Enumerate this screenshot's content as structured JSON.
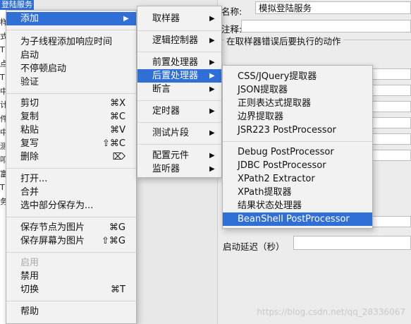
{
  "background": {
    "tree_selected": "登陆服务",
    "tree_chars": [
      "样",
      "式",
      "T",
      "点",
      "T",
      "中",
      "计",
      "件",
      "中",
      "测",
      "叩",
      "富",
      "T",
      "务"
    ],
    "name_label": "名称:",
    "name_value": "模拟登陆服务",
    "comment_label": "注释:",
    "group_title": "在取样器错误后要执行的动作",
    "delay_label": "启动延迟（秒）",
    "watermark": "https://blog.csdn.net/qq_28336067"
  },
  "main_menu": {
    "items": [
      {
        "label": "添加",
        "arrow": "▶",
        "highlight": true
      },
      {
        "label": "为子线程添加响应时间"
      },
      {
        "label": "启动"
      },
      {
        "label": "不停顿启动"
      },
      {
        "label": "验证"
      },
      {
        "label": "剪切",
        "shortcut": "⌘X"
      },
      {
        "label": "复制",
        "shortcut": "⌘C"
      },
      {
        "label": "粘贴",
        "shortcut": "⌘V"
      },
      {
        "label": "复写",
        "shortcut": "⇧⌘C"
      },
      {
        "label": "删除",
        "shortcut": "⌦"
      },
      {
        "label": "打开..."
      },
      {
        "label": "合并"
      },
      {
        "label": "选中部分保存为..."
      },
      {
        "label": "保存节点为图片",
        "shortcut": "⌘G"
      },
      {
        "label": "保存屏幕为图片",
        "shortcut": "⇧⌘G"
      },
      {
        "label": "启用",
        "disabled": true
      },
      {
        "label": "禁用"
      },
      {
        "label": "切换",
        "shortcut": "⌘T"
      },
      {
        "label": "帮助"
      }
    ]
  },
  "add_menu": {
    "items": [
      {
        "label": "取样器",
        "arrow": "▶"
      },
      {
        "label": "逻辑控制器",
        "arrow": "▶"
      },
      {
        "label": "前置处理器",
        "arrow": "▶"
      },
      {
        "label": "后置处理器",
        "arrow": "▶",
        "highlight": true
      },
      {
        "label": "断言",
        "arrow": "▶"
      },
      {
        "label": "定时器",
        "arrow": "▶"
      },
      {
        "label": "测试片段",
        "arrow": "▶"
      },
      {
        "label": "配置元件",
        "arrow": "▶"
      },
      {
        "label": "监听器",
        "arrow": "▶"
      }
    ]
  },
  "post_menu": {
    "items": [
      {
        "label": "CSS/JQuery提取器"
      },
      {
        "label": "JSON提取器"
      },
      {
        "label": "正则表达式提取器"
      },
      {
        "label": "边界提取器"
      },
      {
        "label": "JSR223 PostProcessor"
      },
      {
        "label": "Debug PostProcessor"
      },
      {
        "label": "JDBC PostProcessor"
      },
      {
        "label": "XPath2 Extractor"
      },
      {
        "label": "XPath提取器"
      },
      {
        "label": "结果状态处理器"
      },
      {
        "label": "BeanShell PostProcessor",
        "highlight": true
      }
    ]
  },
  "colors": {
    "highlight": "#2f6fd6",
    "menu_bg": "#f2f2f2"
  }
}
